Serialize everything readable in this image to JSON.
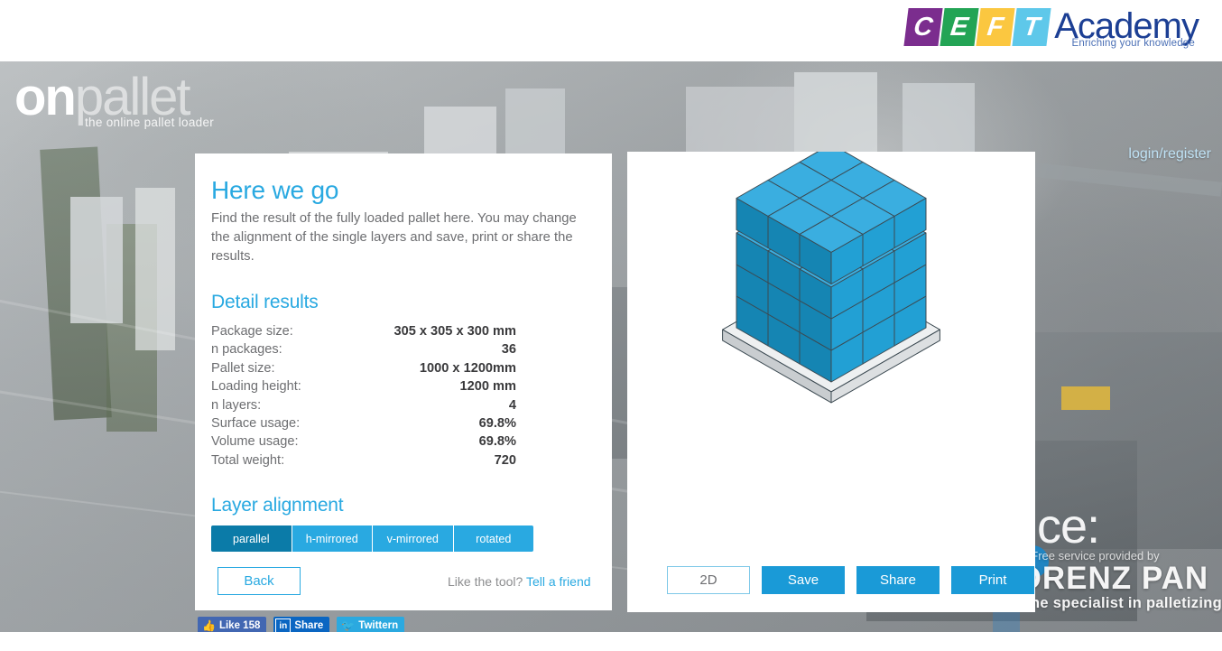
{
  "brand": {
    "ceft": {
      "letters": [
        "C",
        "E",
        "F",
        "T"
      ],
      "letter_colors": [
        "#7b2d8e",
        "#23a455",
        "#fbc740",
        "#5ec8ea"
      ],
      "word": "Academy",
      "tagline": "Enriching your knowledge",
      "word_color": "#1c3f94"
    },
    "onpallet": {
      "name_bold": "on",
      "name_light": "pallet",
      "tagline": "the online pallet loader"
    },
    "sponsor": {
      "prefix": "Free service provided by",
      "name": "LORENZ PAN",
      "tagline": "the specialist in palletizing"
    },
    "background_watermark": "nce:"
  },
  "header": {
    "login_link": "login/register"
  },
  "left_panel": {
    "title": "Here we go",
    "intro": "Find the result of the fully loaded pallet here. You may change the alignment of the single layers and save, print or share the results.",
    "results_title": "Detail results",
    "results": [
      {
        "label": "Package size:",
        "value": "305 x 305 x 300 mm"
      },
      {
        "label": "n packages:",
        "value": "36"
      },
      {
        "label": "Pallet size:",
        "value": "1000 x 1200mm"
      },
      {
        "label": "Loading height:",
        "value": "1200 mm"
      },
      {
        "label": "n layers:",
        "value": "4"
      },
      {
        "label": "Surface usage:",
        "value": "69.8%"
      },
      {
        "label": "Volume usage:",
        "value": "69.8%"
      },
      {
        "label": "Total weight:",
        "value": "720"
      }
    ],
    "alignment_title": "Layer alignment",
    "alignment_options": [
      {
        "label": "parallel",
        "active": true
      },
      {
        "label": "h-mirrored",
        "active": false
      },
      {
        "label": "v-mirrored",
        "active": false
      },
      {
        "label": "rotated",
        "active": false
      }
    ],
    "back_button": "Back",
    "tell_prefix": "Like the tool?",
    "tell_link": "Tell a friend"
  },
  "right_panel": {
    "actions": [
      {
        "label": "2D",
        "style": "ghost"
      },
      {
        "label": "Save",
        "style": "solid"
      },
      {
        "label": "Share",
        "style": "solid"
      },
      {
        "label": "Print",
        "style": "solid"
      }
    ],
    "pallet": {
      "columns": 3,
      "rows": 3,
      "layers": 4,
      "boxes_total": 36,
      "top_face_color": "#3aaee0",
      "left_face_color": "#1585b3",
      "right_face_color": "#22a0d4",
      "pallet_color": "#e8eaec"
    }
  },
  "social": {
    "facebook": {
      "label": "Like",
      "count": "158",
      "icon": "thumbs-up-icon"
    },
    "linkedin": {
      "label": "Share",
      "icon": "linkedin-icon"
    },
    "twitter": {
      "label": "Twittern",
      "icon": "twitter-bird-icon"
    }
  },
  "colors": {
    "accent": "#29a9e1",
    "accent_dark": "#0b7ba8",
    "text_muted": "#6d6e71",
    "text_strong": "#3a3a3c"
  }
}
